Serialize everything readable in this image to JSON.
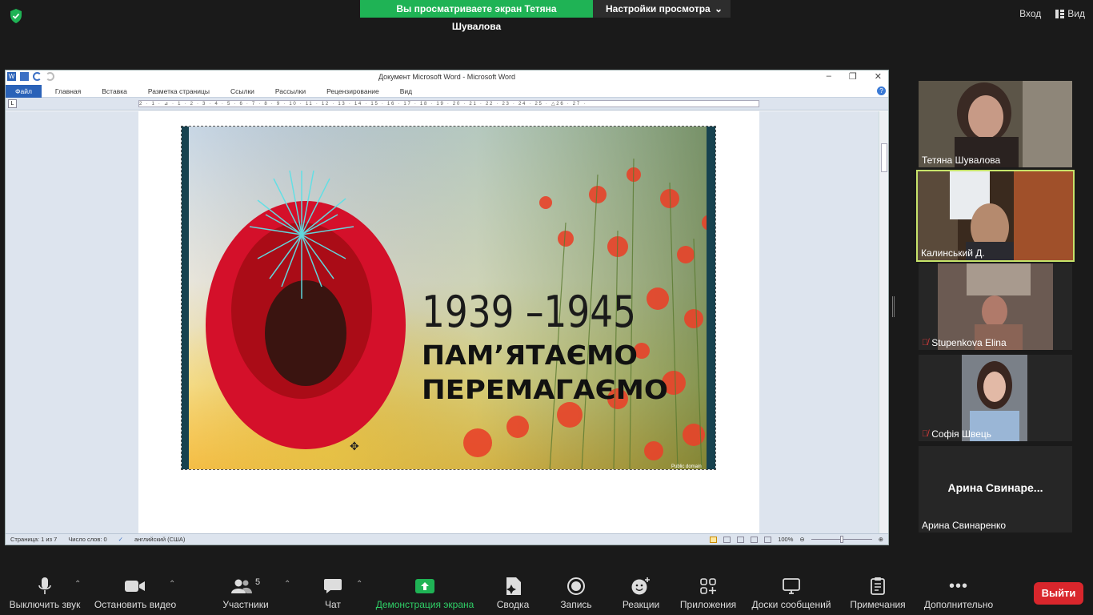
{
  "top": {
    "share_notice": "Вы просматриваете экран Тетяна Шувалова",
    "view_settings": "Настройки просмотра",
    "login": "Вход",
    "view": "Вид"
  },
  "word": {
    "title": "Документ Microsoft Word - Microsoft Word",
    "tabs": [
      "Файл",
      "Главная",
      "Вставка",
      "Разметка страницы",
      "Ссылки",
      "Рассылки",
      "Рецензирование",
      "Вид"
    ],
    "ruler": "2 · 1 · ⊿ · 1 · 2 · 3 · 4 · 5 · 6 · 7 · 8 · 9 · 10 · 11 · 12 · 13 · 14 · 15 · 16 · 17 · 18 · 19 · 20 · 21 · 22 · 23 · 24 · 25 · △26 · 27 ·",
    "poster": {
      "years": "1939 –1945",
      "line1": "ПАМ’ЯТАЄМО",
      "line2": "ПЕРЕМАГАЄМО",
      "credit": "Public domain"
    },
    "status": {
      "page": "Страница: 1 из 7",
      "words": "Число слов: 0",
      "lang": "английский (США)",
      "zoom": "100%"
    }
  },
  "participants": [
    {
      "name": "Тетяна Шувалова",
      "muted": false
    },
    {
      "name": "Калинський Д.",
      "muted": false,
      "active": true
    },
    {
      "name": "Stupenkova Elina",
      "muted": true
    },
    {
      "name": "Софія Швець",
      "muted": true
    },
    {
      "name": "Арина Свинаренко",
      "display": "Арина Свинаре...",
      "muted": false
    }
  ],
  "toolbar": {
    "mute": "Выключить звук",
    "video": "Остановить видео",
    "participants": "Участники",
    "participants_count": "5",
    "chat": "Чат",
    "share": "Демонстрация экрана",
    "summary": "Сводка",
    "record": "Запись",
    "reactions": "Реакции",
    "apps": "Приложения",
    "whiteboards": "Доски сообщений",
    "notes": "Примечания",
    "more": "Дополнительно",
    "leave": "Выйти"
  },
  "colors": {
    "share_green": "#1fb355",
    "leave_red": "#d9262c",
    "active_speaker": "#c6e36a",
    "word_blue": "#2a62b8"
  }
}
